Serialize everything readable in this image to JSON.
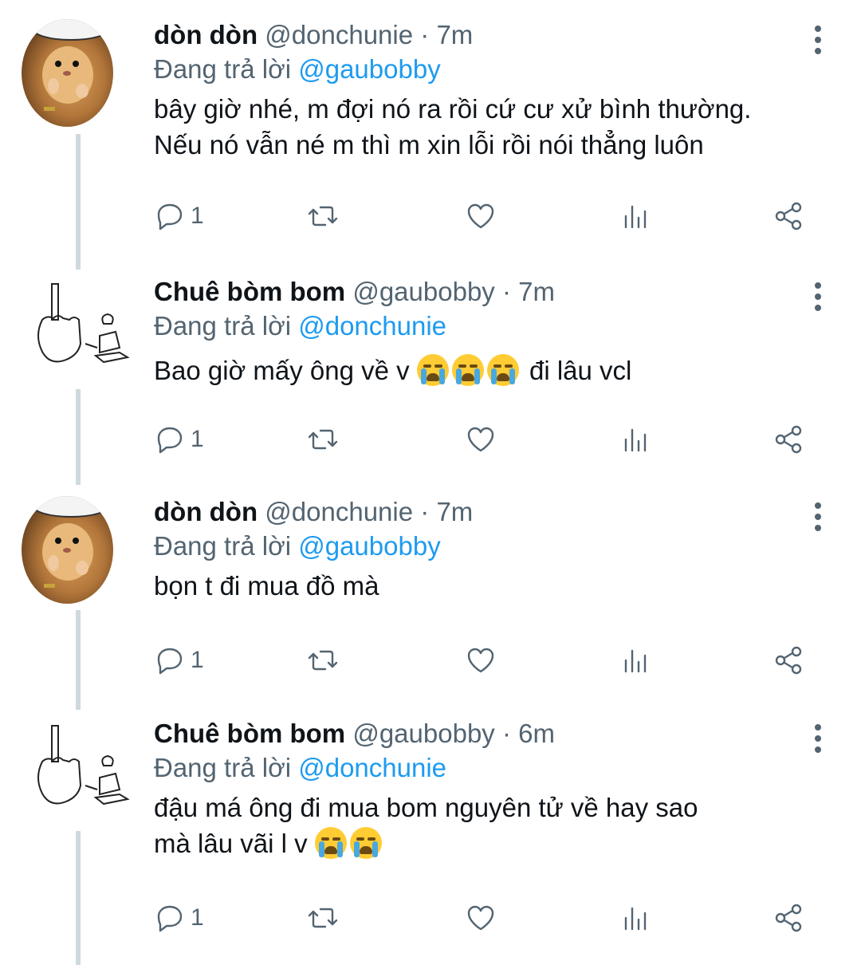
{
  "tweets": [
    {
      "name": "dòn dòn",
      "handle": "@donchunie",
      "dot": "·",
      "time": "7m",
      "reply_prefix": "Đang trả lời",
      "reply_to": "@gaubobby",
      "text_line1": "bây giờ nhé, m đợi nó ra rồi cứ cư xử bình thường.",
      "text_line2": "Nếu nó vẫn né m thì m xin lỗi rồi nói thẳng luôn",
      "reply_count": "1",
      "avatar_icon": "hamster-avatar"
    },
    {
      "name": "Chuê bòm bom",
      "handle": "@gaubobby",
      "dot": "·",
      "time": "7m",
      "reply_prefix": "Đang trả lời",
      "reply_to": "@donchunie",
      "text_before": "Bao giờ mấy ông về v",
      "text_after": "đi lâu vcl",
      "emoji": "loudly-crying-face",
      "emoji_count": 3,
      "reply_count": "1",
      "avatar_icon": "doodle-avatar"
    },
    {
      "name": "dòn dòn",
      "handle": "@donchunie",
      "dot": "·",
      "time": "7m",
      "reply_prefix": "Đang trả lời",
      "reply_to": "@gaubobby",
      "text_line1": "bọn t đi mua đồ mà",
      "reply_count": "1",
      "avatar_icon": "hamster-avatar"
    },
    {
      "name": "Chuê bòm bom",
      "handle": "@gaubobby",
      "dot": "·",
      "time": "6m",
      "reply_prefix": "Đang trả lời",
      "reply_to": "@donchunie",
      "text_line1": "đậu má ông đi mua bom nguyên tử về hay sao",
      "text_line2": "mà lâu vãi l v",
      "emoji": "loudly-crying-face",
      "emoji_count": 2,
      "reply_count": "1",
      "avatar_icon": "doodle-avatar"
    }
  ],
  "icons": {
    "reply": "reply-bubble-icon",
    "retweet": "retweet-icon",
    "like": "heart-icon",
    "analytics": "analytics-bars-icon",
    "share": "share-icon",
    "more": "more-vertical-icon"
  },
  "colors": {
    "mention": "#1d9bf0",
    "secondary": "#536471",
    "thread_line": "#cfd9de"
  }
}
